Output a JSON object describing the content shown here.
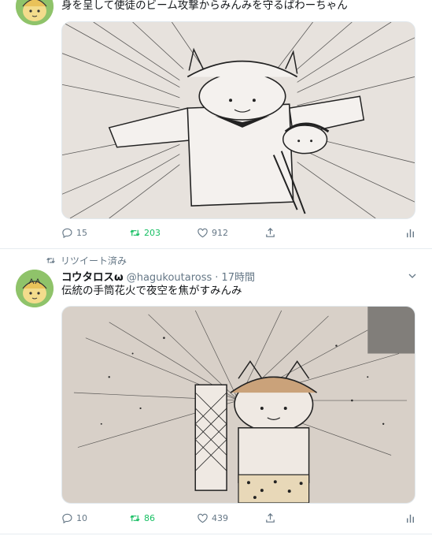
{
  "tweets": [
    {
      "text": "身を呈して使徒のビーム攻撃からみんみを守るぱわーちゃん",
      "stats": {
        "replies": "15",
        "retweets": "203",
        "likes": "912"
      }
    },
    {
      "retweeted_label": "リツイート済み",
      "display_name": "コウタロスω",
      "handle": "@hagukoutaross",
      "separator": "·",
      "time": "17時間",
      "text": "伝統の手筒花火で夜空を焦がすみんみ",
      "stats": {
        "replies": "10",
        "retweets": "86",
        "likes": "439"
      }
    }
  ],
  "icons": {
    "reply": "reply-icon",
    "retweet": "retweet-icon",
    "like": "heart-icon",
    "share": "share-icon",
    "analytics": "analytics-icon",
    "caret": "chevron-down-icon"
  },
  "colors": {
    "text": "#14171a",
    "secondary": "#657786",
    "retweet_active": "#17bf63",
    "divider": "#e6ecf0",
    "avatar_bg": "#8fc36a",
    "paper": "#e6e1dc"
  }
}
